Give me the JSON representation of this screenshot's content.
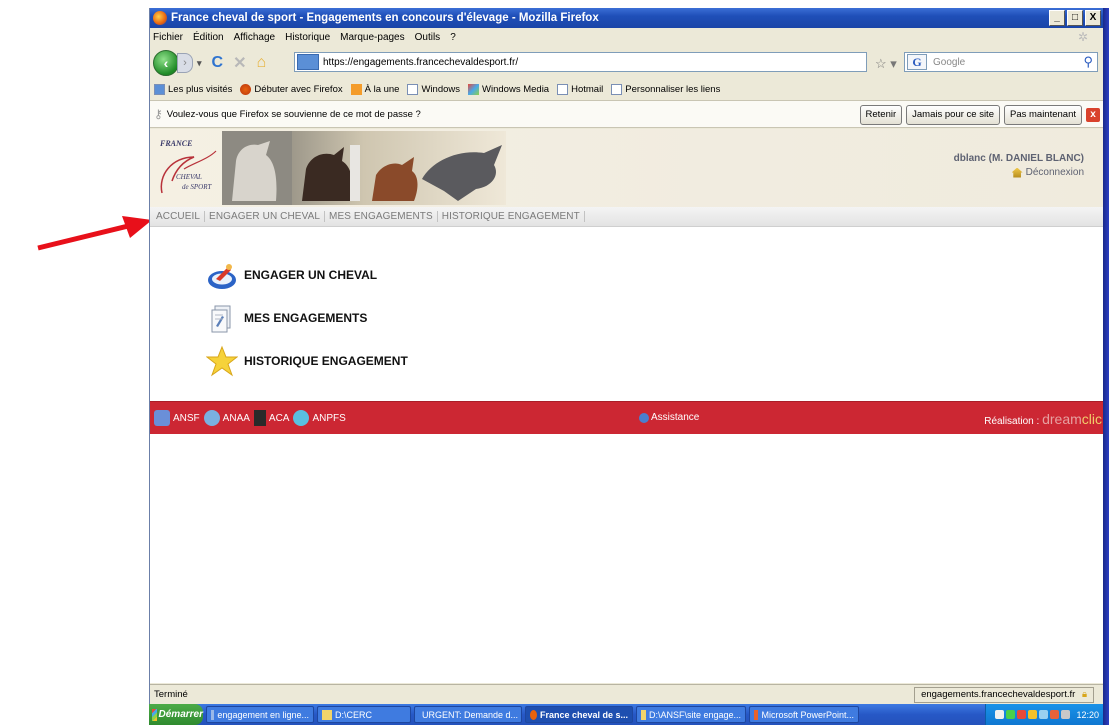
{
  "window": {
    "title": "France cheval de sport - Engagements en concours d'élevage - Mozilla Firefox",
    "buttons": [
      "_",
      "□",
      "X"
    ]
  },
  "menubar": [
    "Fichier",
    "Édition",
    "Affichage",
    "Historique",
    "Marque-pages",
    "Outils",
    "?"
  ],
  "navbar": {
    "url": "https://engagements.francechevaldesport.fr/",
    "search_placeholder": "Google"
  },
  "bookmarks": [
    "Les plus visités",
    "Débuter avec Firefox",
    "À la une",
    "Windows",
    "Windows Media",
    "Hotmail",
    "Personnaliser les liens"
  ],
  "password_bar": {
    "message": "Voulez-vous que Firefox se souvienne de ce mot de passe ?",
    "remember": "Retenir",
    "never": "Jamais pour ce site",
    "not_now": "Pas maintenant"
  },
  "site": {
    "logo": {
      "line1": "FRANCE",
      "line2": "CHEVAL",
      "line3": "de SPORT"
    },
    "user": "dblanc (M. DANIEL BLANC)",
    "logout": "Déconnexion",
    "nav": [
      "ACCUEIL",
      "ENGAGER UN CHEVAL",
      "MES ENGAGEMENTS",
      "HISTORIQUE ENGAGEMENT"
    ],
    "menu": [
      {
        "label": "ENGAGER UN CHEVAL",
        "icon": "horse-rider-icon"
      },
      {
        "label": "MES ENGAGEMENTS",
        "icon": "document-icon"
      },
      {
        "label": "HISTORIQUE ENGAGEMENT",
        "icon": "star-icon"
      }
    ],
    "footer": {
      "partners": [
        "ANSF",
        "ANAA",
        "ACA",
        "ANPFS"
      ],
      "assistance": "Assistance",
      "realisation": "Réalisation :",
      "brand_a": "dream",
      "brand_b": "clic"
    }
  },
  "status": {
    "text": "Terminé",
    "domain": "engagements.francechevaldesport.fr"
  },
  "taskbar": {
    "start": "Démarrer",
    "tasks": [
      "engagement en ligne...",
      "D:\\CERC",
      "URGENT: Demande d...",
      "France cheval de s...",
      "D:\\ANSF\\site engage...",
      "Microsoft PowerPoint..."
    ],
    "clock": "12:20"
  },
  "colors": {
    "footer": "#cc2733",
    "titlebar": "#1f4fb8",
    "annotation_arrow": "#e8101a"
  }
}
